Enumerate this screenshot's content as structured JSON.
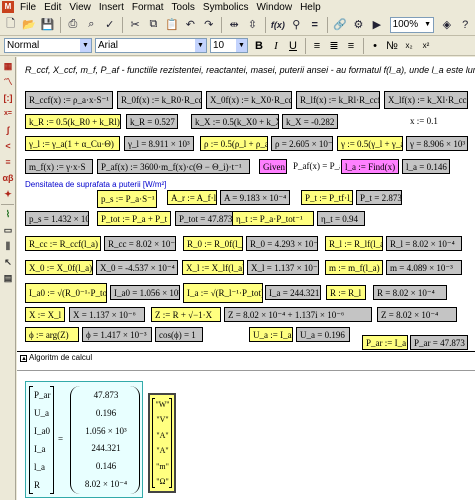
{
  "menubar": {
    "app_icon": "mathcad-icon",
    "items": [
      "File",
      "Edit",
      "View",
      "Insert",
      "Format",
      "Tools",
      "Symbolics",
      "Window",
      "Help"
    ]
  },
  "toolbar": {
    "zoom": "100%",
    "icons": [
      "new-document-icon",
      "open-icon",
      "save-icon",
      "print-icon",
      "print-preview-icon",
      "spell-check-icon",
      "cut-icon",
      "copy-icon",
      "paste-icon",
      "undo-icon",
      "redo-icon",
      "align-horizontal-icon",
      "align-vertical-icon",
      "insert-function-icon",
      "insert-unit-icon",
      "calculate-icon",
      "insert-hyperlink-icon",
      "component-wizard-icon",
      "run-script-icon",
      "resources-icon",
      "help-icon"
    ],
    "function_glyph": "f(x)",
    "equals_glyph": "="
  },
  "format_bar": {
    "style": "Normal",
    "font": "Arial",
    "size": "10",
    "bold": "B",
    "italic": "I",
    "underline": "U"
  },
  "palette": [
    "calculator-palette-icon",
    "graph-palette-icon",
    "matrix-palette-icon",
    "evaluation-palette-icon",
    "calculus-palette-icon",
    "boolean-palette-icon",
    "programming-palette-icon",
    "greek-palette-icon",
    "symbolic-palette-icon",
    "resources-icon"
  ],
  "document": {
    "heading": "R_ccf, X_ccf, m_f, P_af - functiile rezistentei, reactantei, masei, puterii ansei - au formatul f(l_a), unde l_a este lungimea ansei",
    "row1": [
      "R_ccf(x) := ρ_a·x·S⁻¹",
      "R_0f(x) := k_R0·R_ccf(x)",
      "X_0f(x) := k_X0·R_ccf(x)",
      "R_lf(x) := k_Rl·R_ccf(x)",
      "X_lf(x) := k_Xl·R_ccf(x)"
    ],
    "row2": [
      "k_R := 0.5(k_R0 + k_Rl)",
      "k_R = 0.527",
      "k_X := 0.5(k_X0 + k_Xl)",
      "k_X = -0.282",
      "x := 0.1"
    ],
    "row3": [
      "γ_l := γ_a(1 + α_Cu·Θ)",
      "γ_l = 8.911 × 10³",
      "ρ := 0.5(ρ_l + ρ_a)",
      "ρ = 2.605 × 10⁻⁸",
      "γ := 0.5(γ_l + γ_a)",
      "γ = 8.906 × 10³"
    ],
    "row4": [
      "m_f(x) := γ·x·S",
      "P_af(x) := 3600·m_f(x)·c(Θ − Θ_i)·t⁻¹",
      "Given",
      "P_af(x) = P_a",
      "l_a := Find(x)",
      "l_a = 0.146"
    ],
    "note": "Densitatea de suprafata a puterii [W/m²]",
    "row5": [
      "p_s := P_a·S⁻¹",
      "A_r := A_f·l_a",
      "A = 9.183 × 10⁻⁴",
      "P_t := P_tf·l_a",
      "P_t = 2.873"
    ],
    "row6": [
      "p_s = 1.432 × 10⁷",
      "P_tot := P_a + P_t",
      "P_tot = 47.873",
      "η_t := P_a·P_tot⁻¹",
      "η_t = 0.94"
    ],
    "row7": [
      "R_cc := R_ccf(l_a)",
      "R_cc = 8.02 × 10⁻⁴",
      "R_0 := R_0f(l_a)",
      "R_0 = 4.293 × 10⁻⁵",
      "R_l := R_lf(l_a)",
      "R_l = 8.02 × 10⁻⁴"
    ],
    "row8": [
      "X_0 := X_0f(l_a)",
      "X_0 = -4.537 × 10⁻⁴",
      "X_l := X_lf(l_a)",
      "X_l = 1.137 × 10⁻⁶",
      "m := m_f(l_a)",
      "m = 4.089 × 10⁻³"
    ],
    "row9": [
      "I_a0 := √(R_0⁻¹·P_tot)",
      "I_a0 = 1.056 × 10³",
      "I_a := √(R_l⁻¹·P_tot)",
      "I_a = 244.321",
      "R := R_l",
      "R = 8.02 × 10⁻⁴"
    ],
    "row10": [
      "X := X_l",
      "X = 1.137 × 10⁻⁶",
      "Z := R + √−1·X",
      "Z = 8.02 × 10⁻⁴ + 1.137i × 10⁻⁶",
      "Z = 8.02 × 10⁻⁴"
    ],
    "row11": [
      "ϕ := arg(Z)",
      "ϕ = 1.417 × 10⁻³",
      "cos(ϕ) = 1",
      "U_a := I_a·Z",
      "U_a = 0.196",
      "P_ar := I_a·U_a",
      "P_ar = 47.873"
    ],
    "region_label": "Algoritm de calcul",
    "results": {
      "names": [
        "P_ar",
        "U_a",
        "I_a0",
        "I_a",
        "l_a",
        "R"
      ],
      "equals": "=",
      "values": [
        "47.873",
        "0.196",
        "1.056 × 10³",
        "244.321",
        "0.146",
        "8.02 × 10⁻⁴"
      ]
    },
    "units": [
      "\"W\"",
      "\"V\"",
      "\"A\"",
      "\"A\"",
      "\"m\"",
      "\"Ω\""
    ]
  }
}
